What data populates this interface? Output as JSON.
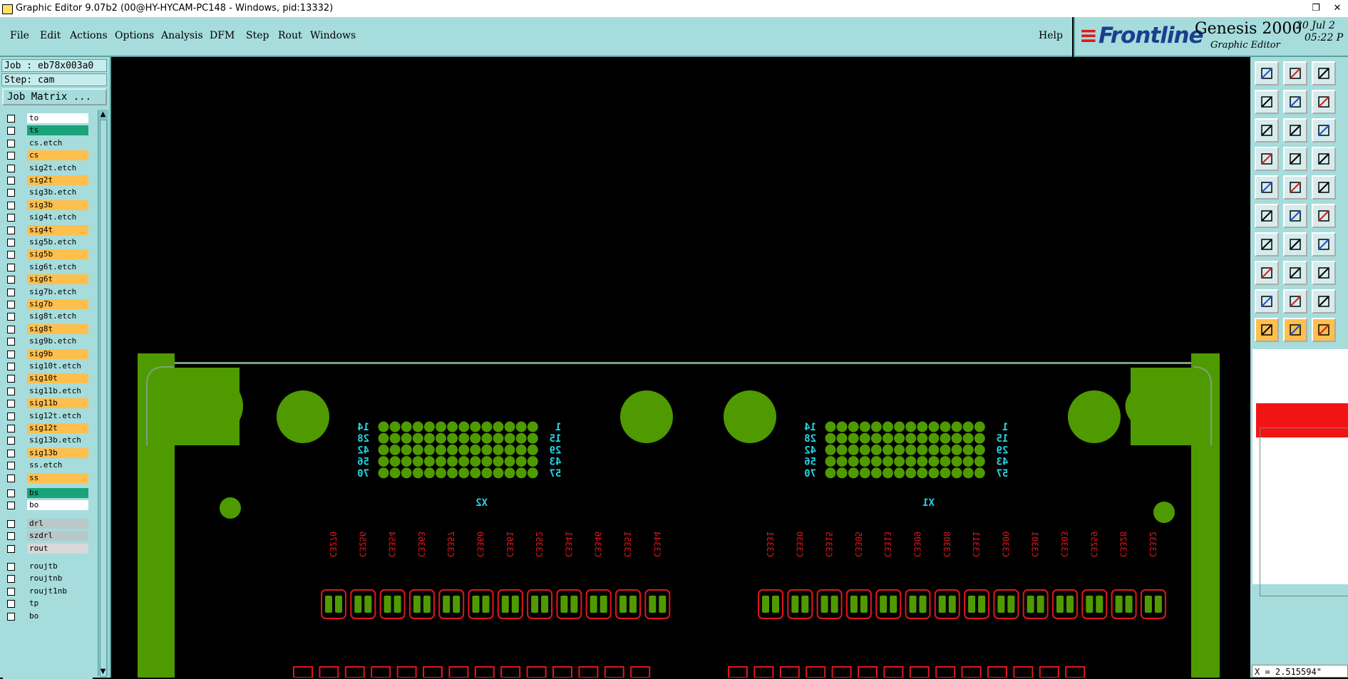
{
  "window": {
    "title": "Graphic Editor 9.07b2 (00@HY-HYCAM-PC148 - Windows, pid:13332)",
    "restore_glyph": "❐",
    "close_glyph": "✕"
  },
  "menu": {
    "file": "File",
    "edit": "Edit",
    "actions": "Actions",
    "options": "Options",
    "analysis": "Analysis",
    "dfm": "DFM",
    "step": "Step",
    "rout": "Rout",
    "windows": "Windows",
    "help": "Help"
  },
  "brand": {
    "logo": "Frontline",
    "product": "Genesis 2000",
    "subtitle": "Graphic Editor",
    "date_line1": "20 Jul 2",
    "date_line2": "05:22 P"
  },
  "job": {
    "job_line": "Job : eb78x003a0",
    "step_line": "Step: cam",
    "matrix_button": "Job Matrix ..."
  },
  "layers": [
    {
      "name": "to",
      "color": "#ffffff"
    },
    {
      "name": "ts",
      "color": "#1aa37a"
    },
    {
      "name": "cs.etch",
      "color": "#a6dcdc"
    },
    {
      "name": "cs",
      "color": "#ffbf4d"
    },
    {
      "name": "sig2t.etch",
      "color": "#a6dcdc"
    },
    {
      "name": "sig2t",
      "color": "#ffbf4d"
    },
    {
      "name": "sig3b.etch",
      "color": "#a6dcdc"
    },
    {
      "name": "sig3b",
      "color": "#ffbf4d"
    },
    {
      "name": "sig4t.etch",
      "color": "#a6dcdc"
    },
    {
      "name": "sig4t",
      "color": "#ffbf4d"
    },
    {
      "name": "sig5b.etch",
      "color": "#a6dcdc"
    },
    {
      "name": "sig5b",
      "color": "#ffbf4d"
    },
    {
      "name": "sig6t.etch",
      "color": "#a6dcdc"
    },
    {
      "name": "sig6t",
      "color": "#ffbf4d"
    },
    {
      "name": "sig7b.etch",
      "color": "#a6dcdc"
    },
    {
      "name": "sig7b",
      "color": "#ffbf4d"
    },
    {
      "name": "sig8t.etch",
      "color": "#a6dcdc"
    },
    {
      "name": "sig8t",
      "color": "#ffbf4d"
    },
    {
      "name": "sig9b.etch",
      "color": "#a6dcdc"
    },
    {
      "name": "sig9b",
      "color": "#ffbf4d"
    },
    {
      "name": "sig10t.etch",
      "color": "#a6dcdc"
    },
    {
      "name": "sig10t",
      "color": "#ffbf4d"
    },
    {
      "name": "sig11b.etch",
      "color": "#a6dcdc"
    },
    {
      "name": "sig11b",
      "color": "#ffbf4d"
    },
    {
      "name": "sig12t.etch",
      "color": "#a6dcdc"
    },
    {
      "name": "sig12t",
      "color": "#ffbf4d"
    },
    {
      "name": "sig13b.etch",
      "color": "#a6dcdc"
    },
    {
      "name": "sig13b",
      "color": "#ffbf4d"
    },
    {
      "name": "ss.etch",
      "color": "#a6dcdc"
    },
    {
      "name": "ss",
      "color": "#ffbf4d"
    },
    {
      "name": "bs",
      "color": "#1aa37a"
    },
    {
      "name": "bo",
      "color": "#ffffff"
    },
    {
      "name": "drl",
      "color": "#b8c8c8"
    },
    {
      "name": "szdrl",
      "color": "#b8c8c8"
    },
    {
      "name": "rout",
      "color": "#d8d8d8"
    },
    {
      "name": "roujtb",
      "color": "#a6dcdc"
    },
    {
      "name": "roujtnb",
      "color": "#a6dcdc"
    },
    {
      "name": "roujt1nb",
      "color": "#a6dcdc"
    },
    {
      "name": "tp",
      "color": "#a6dcdc"
    },
    {
      "name": "bo",
      "color": "#a6dcdc"
    }
  ],
  "board": {
    "connector_left": {
      "ref": "X2",
      "left_labels": [
        "14",
        "28",
        "42",
        "56",
        "70"
      ],
      "right_labels": [
        "1",
        "15",
        "29",
        "43",
        "57"
      ]
    },
    "connector_right": {
      "ref": "X1",
      "left_labels": [
        "14",
        "28",
        "42",
        "56",
        "70"
      ],
      "right_labels": [
        "1",
        "15",
        "29",
        "43",
        "57"
      ]
    },
    "caps_left": [
      "C3270",
      "C3256",
      "C3354",
      "C3363",
      "C3357",
      "C3360",
      "C3361",
      "C3352",
      "C3341",
      "C3346",
      "C3351",
      "C3344"
    ],
    "caps_right": [
      "C3331",
      "C3330",
      "C3315",
      "C3305",
      "C3313",
      "C3309",
      "C3308",
      "C3311",
      "C3300",
      "C3301",
      "C3303",
      "C3259",
      "C3328",
      "C3332"
    ],
    "colors": {
      "copper": "#4f9a00",
      "text": "#26d6e6",
      "silk": "#e0171e"
    }
  },
  "tools": [
    "snap-top-icon",
    "save-icon",
    "home-icon",
    "pan-left-icon",
    "pan-right-icon",
    "zoom-back-icon",
    "fit-icon",
    "zoom-home-icon",
    "one-to-one-icon",
    "measure-icon",
    "net-icon",
    "route-icon",
    "feature-icon",
    "shape-icon",
    "ruler-icon",
    "node-icon",
    "cross-icon",
    "connect-icon",
    "angle-icon",
    "line-icon",
    "arc-icon",
    "corner-icon",
    "cut-icon",
    "pad-icon",
    "triangle-icon",
    "arrow-up-icon",
    "letter-a-icon",
    "select-icon",
    "select-active-icon",
    "select-yellow-icon"
  ],
  "status": {
    "coord": "X = 2.515594\""
  }
}
